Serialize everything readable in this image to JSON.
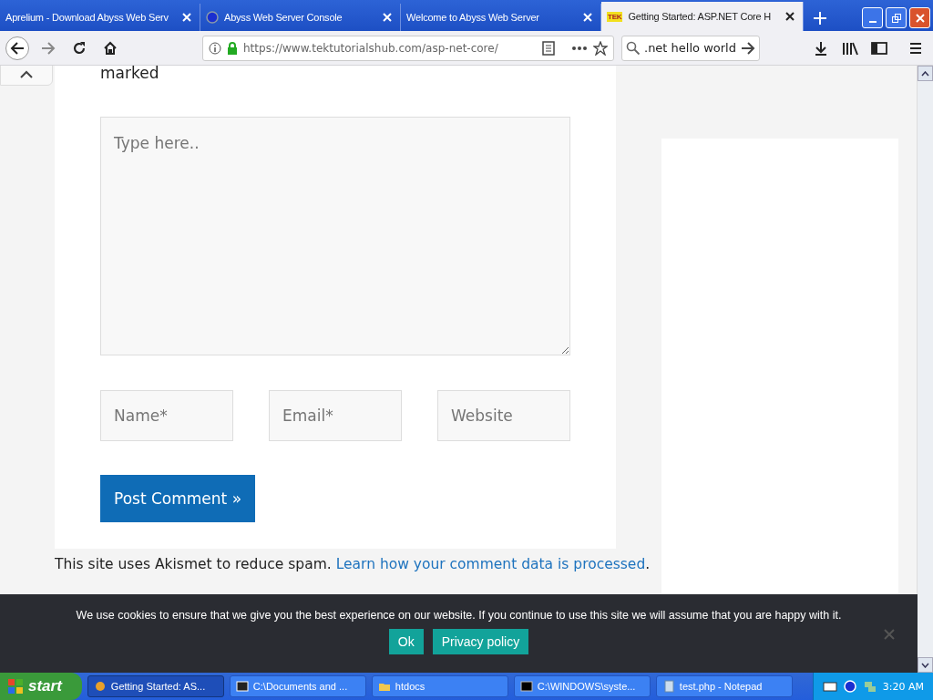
{
  "tabs": [
    {
      "label": "Aprelium - Download Abyss Web Serv",
      "selected": false
    },
    {
      "label": "Abyss Web Server Console",
      "selected": false
    },
    {
      "label": "Welcome to Abyss Web Server",
      "selected": false
    },
    {
      "label": "Getting Started: ASP.NET Core H",
      "selected": true
    }
  ],
  "tek_logo": "TEK",
  "address": "https://www.tektutorialshub.com/asp-net-core/",
  "search": {
    "value": ".net hello world"
  },
  "page": {
    "cut_text": "marked",
    "comment": {
      "placeholder": "Type here.."
    },
    "fields": [
      {
        "placeholder": "Name*"
      },
      {
        "placeholder": "Email*"
      },
      {
        "placeholder": "Website"
      }
    ],
    "submit": "Post Comment »",
    "akismet": "This site uses Akismet to reduce spam.",
    "akismet_link": "Learn how your comment data is processed",
    "akismet_end": "."
  },
  "cookie": {
    "message": "We use cookies to ensure that we give you the best experience on our website. If you continue to use this site we will assume that you are happy with it.",
    "buttons": [
      "Ok",
      "Privacy policy"
    ]
  },
  "taskbar": {
    "start": "start",
    "items": [
      {
        "label": "Getting Started: AS...",
        "selected": true
      },
      {
        "label": "C:\\Documents and ...",
        "selected": false
      },
      {
        "label": "htdocs",
        "selected": false
      },
      {
        "label": "C:\\WINDOWS\\syste...",
        "selected": false
      },
      {
        "label": "test.php - Notepad",
        "selected": false
      }
    ],
    "clock": "3:20 AM"
  }
}
